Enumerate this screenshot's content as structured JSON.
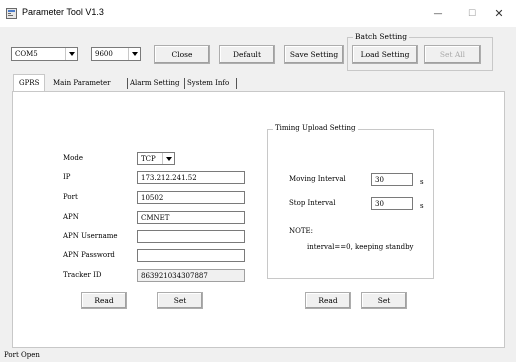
{
  "window": {
    "title": "Parameter Tool V1.3",
    "minimize_glyph": "—",
    "maximize_glyph": "☐",
    "close_glyph": "✕"
  },
  "toolbar": {
    "port_value": "COM5",
    "baud_value": "9600",
    "close_label": "Close",
    "default_label": "Default",
    "save_setting_label": "Save Setting"
  },
  "batch": {
    "group_label": "Batch Setting",
    "load_setting_label": "Load Setting",
    "set_all_label": "Set All"
  },
  "tabs": [
    {
      "label": "GPRS"
    },
    {
      "label": "Main Parameter"
    },
    {
      "label": "Alarm Setting"
    },
    {
      "label": "System Info"
    }
  ],
  "gprs": {
    "mode_label": "Mode",
    "mode_value": "TCP",
    "ip_label": "IP",
    "ip_value": "173.212.241.52",
    "port_label": "Port",
    "port_value": "10502",
    "apn_label": "APN",
    "apn_value": "CMNET",
    "apn_username_label": "APN Username",
    "apn_username_value": "",
    "apn_password_label": "APN Password",
    "apn_password_value": "",
    "tracker_id_label": "Tracker ID",
    "tracker_id_value": "863921034307887",
    "read_label": "Read",
    "set_label": "Set"
  },
  "timing": {
    "group_label": "Timing Upload Setting",
    "moving_interval_label": "Moving Interval",
    "moving_interval_value": "30",
    "stop_interval_label": "Stop Interval",
    "stop_interval_value": "30",
    "unit_label": "s",
    "note_label": "NOTE:",
    "note_text": "interval==0, keeping standby",
    "read_label": "Read",
    "set_label": "Set"
  },
  "status": {
    "text": "Port Open"
  },
  "colors": {
    "window_bg": "#f0f0f0",
    "panel_bg": "#ffffff",
    "border": "#c8c8c8",
    "disabled_text": "#a8a8a8"
  }
}
